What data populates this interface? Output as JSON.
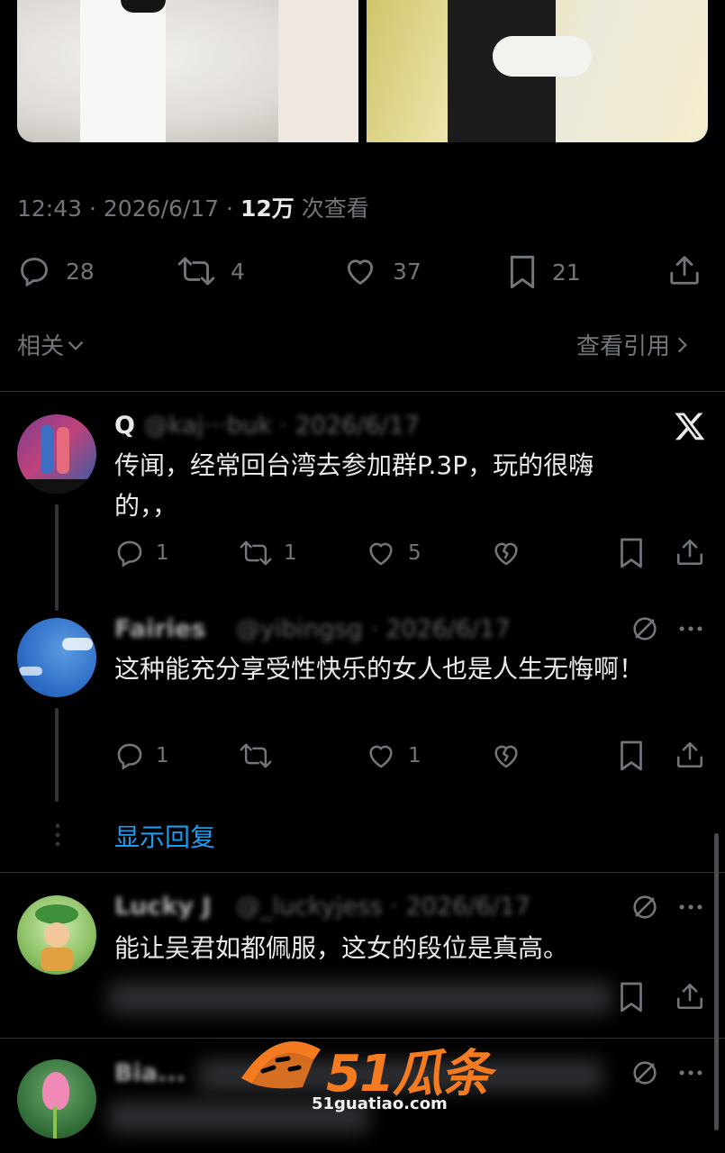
{
  "tweet": {
    "time": "12:43",
    "date": "2026/6/17",
    "views_count": "12万",
    "views_label": "次查看",
    "actions": {
      "replies": "28",
      "retweets": "4",
      "likes": "37",
      "bookmarks": "21"
    }
  },
  "related": {
    "left_label": "相关",
    "right_label": "查看引用"
  },
  "replies": [
    {
      "name": "Q",
      "handle": "@kaj···buk · 2026/6/17",
      "text": "传闻，经常回台湾去参加群P.3P，玩的很嗨的，，",
      "stats": {
        "replies": "1",
        "retweets": "1",
        "likes": "5"
      }
    },
    {
      "name": "Fairies",
      "handle": "@yibingsg · 2026/6/17",
      "text": "这种能充分享受性快乐的女人也是人生无悔啊！",
      "stats": {
        "replies": "1",
        "retweets": "",
        "likes": "1"
      }
    },
    {
      "name": "Lucky J",
      "handle": "@_luckyjess · 2026/6/17",
      "text": "能让吴君如都佩服，这女的段位是真高。"
    },
    {
      "name": "Bia...",
      "handle": "@..."
    }
  ],
  "show_replies_label": "显示回复",
  "watermark": {
    "brand": "51瓜条",
    "url": "51guatiao.com"
  },
  "colors": {
    "background": "#000000",
    "text_primary": "#e7e9ea",
    "text_secondary": "#71767b",
    "link_blue": "#1d9bf0",
    "divider": "#2f3336",
    "watermark_orange": "#f47b20"
  }
}
